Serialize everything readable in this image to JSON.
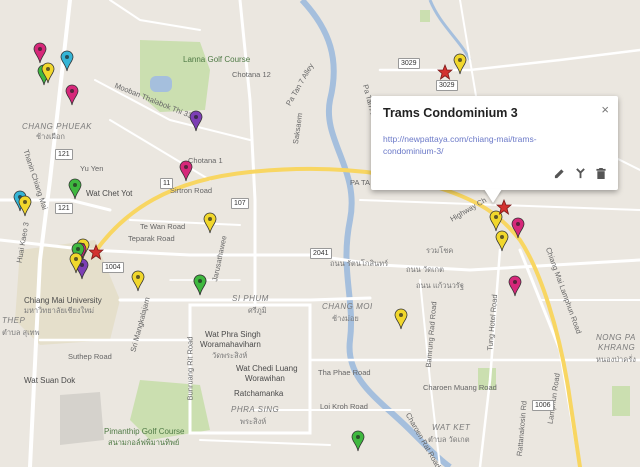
{
  "map": {
    "area_labels": [
      {
        "id": "chang-phueak",
        "text": "CHANG PHUEAK"
      },
      {
        "id": "chang-phueak-th",
        "text": "ช้างเผือก"
      },
      {
        "id": "si-phum",
        "text": "SI PHUM"
      },
      {
        "id": "si-phum-th",
        "text": "ศรีภูมิ"
      },
      {
        "id": "chang-moi",
        "text": "CHANG MOI"
      },
      {
        "id": "chang-moi-th",
        "text": "ช้างม่อย"
      },
      {
        "id": "phra-sing",
        "text": "PHRA SING"
      },
      {
        "id": "phra-sing-th",
        "text": "พระสิงห์"
      },
      {
        "id": "nong-pa-khrang",
        "text": "NONG PA"
      },
      {
        "id": "nong-pa-khrang-2",
        "text": "KHRANG"
      },
      {
        "id": "nong-pa-khrang-th",
        "text": "หนองป่าครั่ง"
      },
      {
        "id": "wat-ket",
        "text": "WAT KET"
      },
      {
        "id": "wat-ket-th",
        "text": "ตำบล วัดเกต"
      },
      {
        "id": "thep",
        "text": "THEP"
      },
      {
        "id": "thep-th",
        "text": "ตำบล สุเทพ"
      }
    ],
    "poi_labels": [
      {
        "id": "lanna-golf",
        "text": "Lanna Golf Course"
      },
      {
        "id": "wat-chet-yot",
        "text": "Wat Chet Yot"
      },
      {
        "id": "cmu",
        "text": "Chiang Mai University"
      },
      {
        "id": "cmu-th",
        "text": "มหาวิทยาลัยเชียงใหม่"
      },
      {
        "id": "wat-phra-singh",
        "text": "Wat Phra Singh"
      },
      {
        "id": "wat-phra-singh-2",
        "text": "Woramahaviharn"
      },
      {
        "id": "wat-phra-singh-th",
        "text": "วัดพระสิงห์"
      },
      {
        "id": "wat-chedi-luang",
        "text": "Wat Chedi Luang"
      },
      {
        "id": "wat-chedi-luang-2",
        "text": "Worawihan"
      },
      {
        "id": "ratchamanka",
        "text": "Ratchamanka"
      },
      {
        "id": "wat-suan-dok",
        "text": "Wat Suan Dok"
      },
      {
        "id": "pimanthip",
        "text": "Pimanthip Golf Course"
      },
      {
        "id": "pimanthip-th",
        "text": "สนามกอล์ฟพิมานทิพย์"
      }
    ],
    "road_labels": [
      {
        "id": "chotana12",
        "text": "Chotana 12"
      },
      {
        "id": "mooban",
        "text": "Mooban Thalabok Thi 33"
      },
      {
        "id": "pa-tan7",
        "text": "Pa Tan 7 Alley"
      },
      {
        "id": "pa-tan-alley",
        "text": "Pa Tan Alley"
      },
      {
        "id": "saksaem",
        "text": "Saksaem"
      },
      {
        "id": "yu-yen",
        "text": "Yu Yen"
      },
      {
        "id": "chotana1",
        "text": "Chotana 1"
      },
      {
        "id": "sirtron",
        "text": "Sirtron Road"
      },
      {
        "id": "te-wan",
        "text": "Te Wan Road"
      },
      {
        "id": "teparak",
        "text": "Teparak Road"
      },
      {
        "id": "jarusathawee",
        "text": "Jarusathawee"
      },
      {
        "id": "thanin",
        "text": "Thanin Chiang Mai"
      },
      {
        "id": "huai-kaeo",
        "text": "Huai Kaeo 3"
      },
      {
        "id": "si-mangkalajarn",
        "text": "Sri Mangkalajarn"
      },
      {
        "id": "suthep",
        "text": "Suthep Road"
      },
      {
        "id": "bunruang",
        "text": "Bunruang Rit Road"
      },
      {
        "id": "tha-phae",
        "text": "Tha Phae Road"
      },
      {
        "id": "loi-kroh",
        "text": "Loi Kroh Road"
      },
      {
        "id": "bamrung-rad",
        "text": "Bamrung Rad Road"
      },
      {
        "id": "charoen-muang",
        "text": "Charoen Muang Road"
      },
      {
        "id": "tung-hotel",
        "text": "Tung Hotel Road"
      },
      {
        "id": "kaeo-nawarat",
        "text": "Chiang Mai Lamphun Road"
      },
      {
        "id": "super-highway",
        "text": "Highway Ch"
      },
      {
        "id": "lamphun",
        "text": "Lamphun Road"
      },
      {
        "id": "rattana",
        "text": "Rattanakosin Rd"
      },
      {
        "id": "charoen-rat",
        "text": "Charoen Rat Road"
      },
      {
        "id": "pa-tan-thai",
        "text": "PA TA"
      },
      {
        "id": "thai-road1",
        "text": "ถนน วัดเกต"
      },
      {
        "id": "thai-road2",
        "text": "ถนน รัตนโกสินทร์"
      },
      {
        "id": "thai-road3",
        "text": "ถนน แก้วนวรัฐ"
      },
      {
        "id": "ruam",
        "text": "รวมโชค"
      }
    ],
    "shields": [
      {
        "id": "r3029a",
        "text": "3029"
      },
      {
        "id": "r3029b",
        "text": "3029"
      },
      {
        "id": "r11",
        "text": "11"
      },
      {
        "id": "r121a",
        "text": "121"
      },
      {
        "id": "r121b",
        "text": "121"
      },
      {
        "id": "r107",
        "text": "107"
      },
      {
        "id": "r1004",
        "text": "1004"
      },
      {
        "id": "r2041",
        "text": "2041"
      },
      {
        "id": "r1006",
        "text": "1006"
      }
    ],
    "colors": {
      "land": "#ebe7e0",
      "road": "#ffffff",
      "highway": "#f8d662",
      "water": "#a5bfdd",
      "park": "#cbdfb0",
      "campus": "#e5dfcb"
    },
    "markers": [
      {
        "id": "m1",
        "color": "#d6287a"
      },
      {
        "id": "m2",
        "color": "#35b5d6"
      },
      {
        "id": "m3",
        "color": "#3fb83f"
      },
      {
        "id": "m4",
        "color": "#f1d72c"
      },
      {
        "id": "m5",
        "color": "#d6287a"
      },
      {
        "id": "m6",
        "color": "#7d3fb5"
      },
      {
        "id": "m7",
        "color": "#d6287a"
      },
      {
        "id": "m8",
        "color": "#3fb83f"
      },
      {
        "id": "m9",
        "color": "#35b5d6"
      },
      {
        "id": "m10",
        "color": "#f1d72c"
      },
      {
        "id": "m11",
        "color": "#f1d72c"
      },
      {
        "id": "m12",
        "color": "#d6287a"
      },
      {
        "id": "m13",
        "color": "#7d3fb5"
      },
      {
        "id": "m14",
        "color": "#3fb83f"
      },
      {
        "id": "m15",
        "color": "#f1d72c"
      },
      {
        "id": "m16",
        "color": "#f1d72c"
      },
      {
        "id": "m17",
        "color": "#35b5d6"
      },
      {
        "id": "m18",
        "color": "#f1d72c"
      },
      {
        "id": "m19",
        "color": "#3fb83f"
      },
      {
        "id": "m20",
        "color": "#f1d72c"
      },
      {
        "id": "m21",
        "color": "#f1d72c"
      },
      {
        "id": "m22",
        "color": "#f1d72c"
      },
      {
        "id": "m23",
        "color": "#d6287a"
      },
      {
        "id": "m24",
        "color": "#d6287a"
      },
      {
        "id": "m25",
        "color": "#f1d72c"
      },
      {
        "id": "m26",
        "color": "#3fb83f"
      }
    ],
    "stars": [
      {
        "id": "s1",
        "color": "#d3322f"
      },
      {
        "id": "s2",
        "color": "#d3322f"
      },
      {
        "id": "s3",
        "color": "#d3322f"
      }
    ]
  },
  "popup": {
    "title": "Trams Condominium 3",
    "link_line1": "http://newpattaya.com/chiang-mai/trams-",
    "link_line2": "condominium-3/",
    "close_icon": "×",
    "edit_icon": "pencil-icon",
    "style_icon": "paint-bucket-icon",
    "delete_icon": "trash-icon"
  }
}
